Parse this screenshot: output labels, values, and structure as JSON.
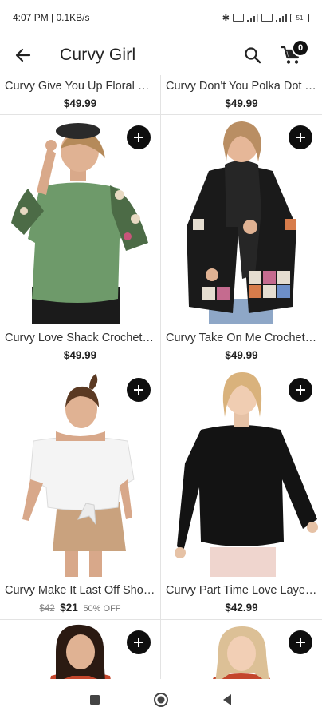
{
  "status_bar": {
    "time": "4:07 PM | 0.1KB/s",
    "battery": "51"
  },
  "header": {
    "title": "Curvy Girl",
    "cart_count": "0"
  },
  "products": [
    {
      "name": "Curvy Give You Up Floral Print Top",
      "price": "$49.99"
    },
    {
      "name": "Curvy Don't You Polka Dot Top",
      "price": "$49.99"
    },
    {
      "name": "Curvy Love Shack Crochet Sleeve Top",
      "price": "$49.99"
    },
    {
      "name": "Curvy Take On Me Crochet Cardigan",
      "price": "$49.99"
    },
    {
      "name": "Curvy Make It Last Off Shoulder Top",
      "old_price": "$42",
      "price": "$21",
      "discount": "50% OFF"
    },
    {
      "name": "Curvy Part Time Love Layered Top",
      "price": "$42.99"
    },
    {
      "name": "",
      "price": ""
    },
    {
      "name": "",
      "price": ""
    }
  ],
  "colors": {
    "accent": "#0e0e0e",
    "divider": "#e3e3e3"
  }
}
